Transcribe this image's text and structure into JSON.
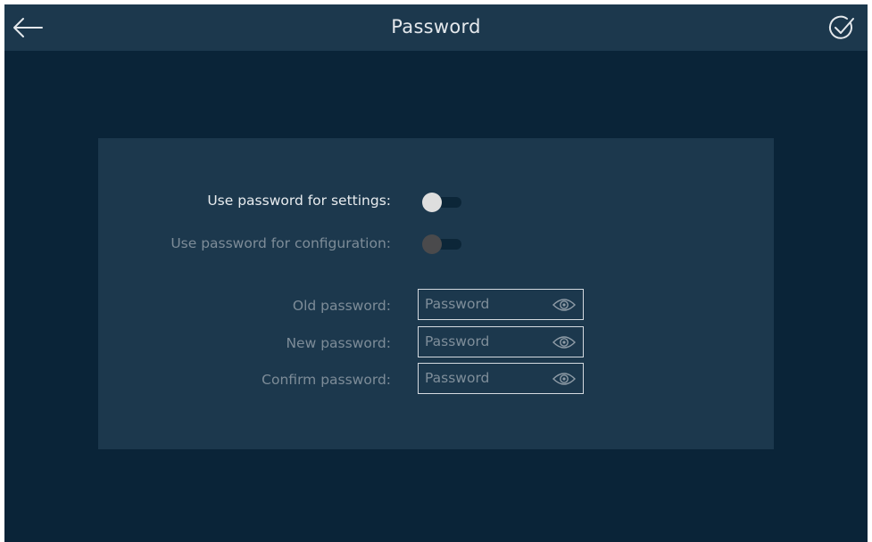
{
  "header": {
    "title": "Password",
    "back_icon": "arrow-left-icon",
    "confirm_icon": "check-circle-icon"
  },
  "settings": {
    "use_for_settings": {
      "label": "Use password for settings:",
      "enabled": true,
      "on": false
    },
    "use_for_configuration": {
      "label": "Use password for configuration:",
      "enabled": false,
      "on": false
    }
  },
  "fields": {
    "old": {
      "label": "Old password:",
      "value": "",
      "placeholder": "Password",
      "icon": "eye-icon"
    },
    "new": {
      "label": "New password:",
      "value": "",
      "placeholder": "Password",
      "icon": "eye-icon"
    },
    "confirm": {
      "label": "Confirm password:",
      "value": "",
      "placeholder": "Password",
      "icon": "eye-icon"
    }
  },
  "colors": {
    "background": "#0a2438",
    "bar": "#1c384d",
    "panel": "#1c384d",
    "text_bright": "#e8ecef",
    "text_dim": "#7d8c98"
  }
}
